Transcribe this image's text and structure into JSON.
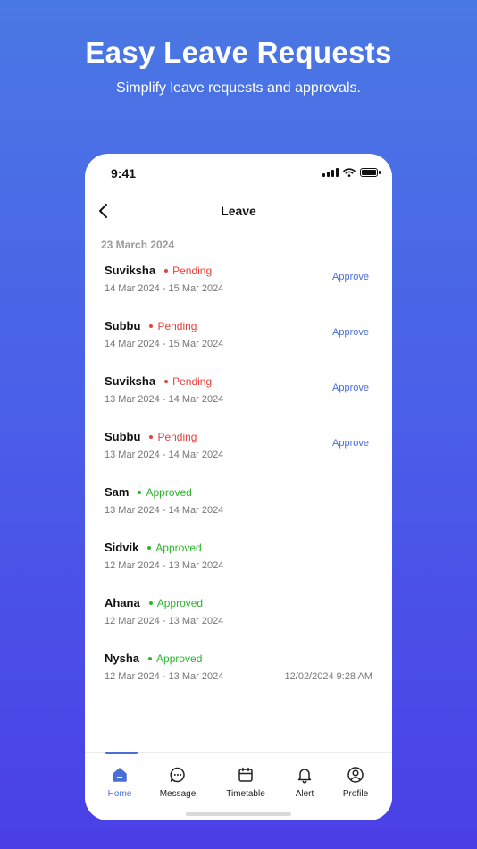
{
  "promo": {
    "title": "Easy Leave Requests",
    "subtitle": "Simplify leave requests and approvals."
  },
  "status_bar": {
    "time": "9:41"
  },
  "header": {
    "title": "Leave"
  },
  "date_heading": "23 March 2024",
  "colors": {
    "pending": "#e8413c",
    "approved": "#2cb52c",
    "accent": "#4a6fd6"
  },
  "leaves": [
    {
      "name": "Suviksha",
      "status": "Pending",
      "dates": "14 Mar 2024 - 15 Mar 2024",
      "action": "Approve"
    },
    {
      "name": "Subbu",
      "status": "Pending",
      "dates": "14 Mar 2024 - 15 Mar 2024",
      "action": "Approve"
    },
    {
      "name": "Suviksha",
      "status": "Pending",
      "dates": "13 Mar 2024 - 14 Mar 2024",
      "action": "Approve"
    },
    {
      "name": "Subbu",
      "status": "Pending",
      "dates": "13 Mar 2024 - 14 Mar 2024",
      "action": "Approve"
    },
    {
      "name": "Sam",
      "status": "Approved",
      "dates": "13 Mar 2024 - 14 Mar 2024"
    },
    {
      "name": "Sidvik",
      "status": "Approved",
      "dates": "12 Mar 2024 - 13 Mar 2024"
    },
    {
      "name": "Ahana",
      "status": "Approved",
      "dates": "12 Mar 2024 - 13 Mar 2024"
    },
    {
      "name": "Nysha",
      "status": "Approved",
      "dates": "12 Mar 2024 - 13 Mar 2024",
      "timestamp": "12/02/2024  9:28 AM"
    }
  ],
  "nav": [
    {
      "label": "Home",
      "icon": "home-icon",
      "active": true
    },
    {
      "label": "Message",
      "icon": "message-icon"
    },
    {
      "label": "Timetable",
      "icon": "calendar-icon"
    },
    {
      "label": "Alert",
      "icon": "bell-icon"
    },
    {
      "label": "Profile",
      "icon": "profile-icon"
    }
  ]
}
